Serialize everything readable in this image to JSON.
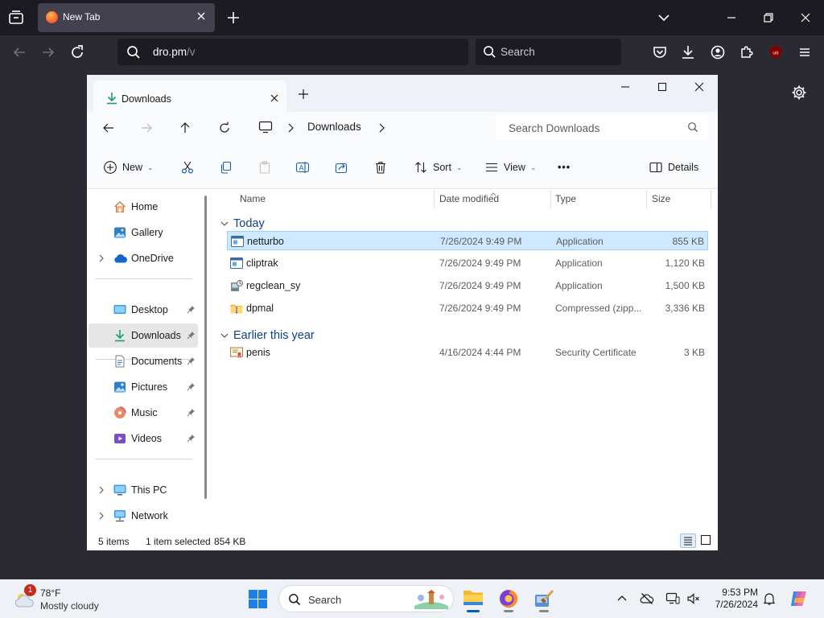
{
  "browser": {
    "tab_title": "New Tab",
    "url_host": "dro.pm",
    "url_path": "/v",
    "search_placeholder": "Search"
  },
  "explorer": {
    "tab_title": "Downloads",
    "breadcrumb": "Downloads",
    "search_placeholder": "Search Downloads",
    "toolbar": {
      "new": "New",
      "sort": "Sort",
      "view": "View",
      "more": "•••",
      "details": "Details"
    },
    "columns": {
      "name": "Name",
      "date": "Date modified",
      "type": "Type",
      "size": "Size"
    },
    "nav": {
      "home": "Home",
      "gallery": "Gallery",
      "onedrive": "OneDrive",
      "desktop": "Desktop",
      "downloads": "Downloads",
      "documents": "Documents",
      "pictures": "Pictures",
      "music": "Music",
      "videos": "Videos",
      "thispc": "This PC",
      "network": "Network"
    },
    "groups": {
      "today": "Today",
      "earlier": "Earlier this year"
    },
    "files": [
      {
        "name": "netturbo",
        "date": "7/26/2024 9:49 PM",
        "type": "Application",
        "size": "855 KB",
        "icon": "application-icon",
        "selected": true
      },
      {
        "name": "cliptrak",
        "date": "7/26/2024 9:49 PM",
        "type": "Application",
        "size": "1,120 KB",
        "icon": "application-icon",
        "selected": false
      },
      {
        "name": "regclean_sy",
        "date": "7/26/2024 9:49 PM",
        "type": "Application",
        "size": "1,500 KB",
        "icon": "installer-icon",
        "selected": false
      },
      {
        "name": "dpmal",
        "date": "7/26/2024 9:49 PM",
        "type": "Compressed (zipp...",
        "size": "3,336 KB",
        "icon": "zip-folder-icon",
        "selected": false
      },
      {
        "name": "penis",
        "date": "4/16/2024 4:44 PM",
        "type": "Security Certificate",
        "size": "3 KB",
        "icon": "certificate-icon",
        "selected": false
      }
    ],
    "status": {
      "count": "5 items",
      "selection": "1 item selected",
      "selection_size": "854 KB"
    }
  },
  "taskbar": {
    "weather_badge": "1",
    "weather_temp": "78°F",
    "weather_cond": "Mostly cloudy",
    "search_label": "Search",
    "time": "9:53 PM",
    "date": "7/26/2024"
  },
  "colors": {
    "accent": "#005fb8",
    "selection": "#cde8ff",
    "firefox_bg": "#2b2a33",
    "firefox_tabbar": "#1c1b22"
  }
}
